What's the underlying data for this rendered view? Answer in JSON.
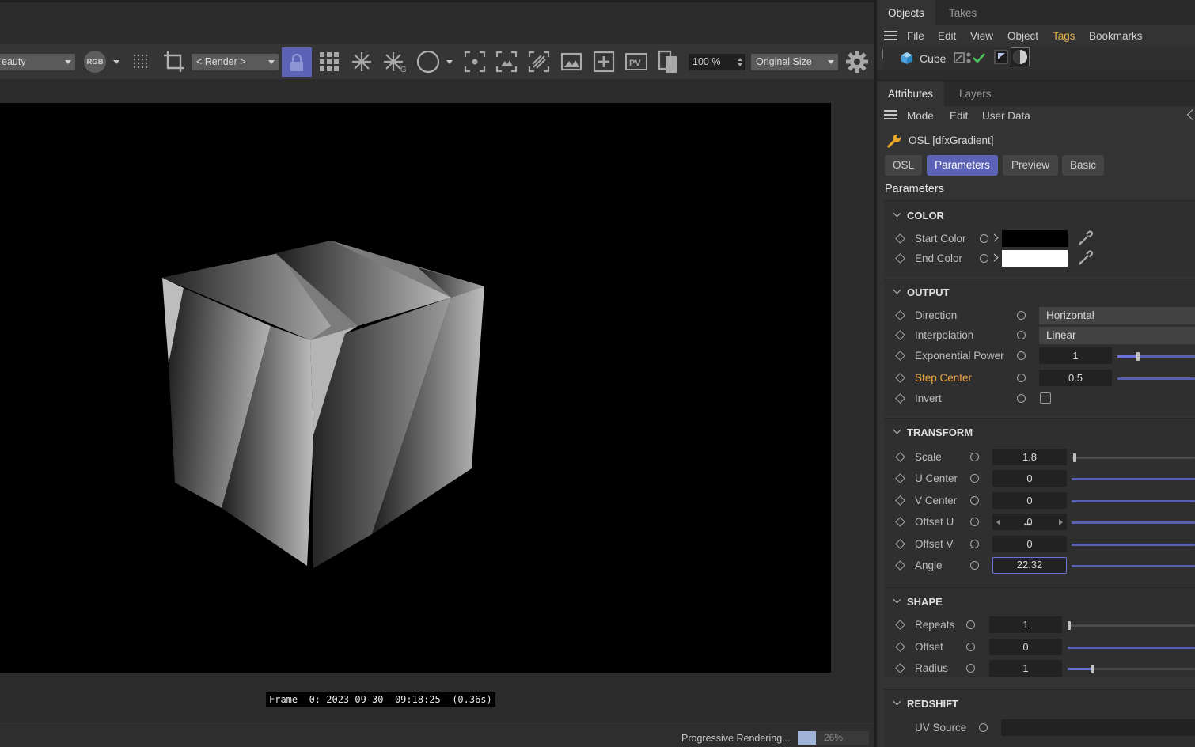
{
  "render_toolbar": {
    "pass_dropdown": "eauty",
    "rgb_label": "RGB",
    "render_dropdown": "< Render >",
    "pv_label": "PV",
    "zoom_value": "100 %",
    "size_dropdown": "Original Size"
  },
  "render_view": {
    "frame_label": "Frame  0: 2023-09-30  09:18:25  (0.36s)",
    "status_text": "Progressive Rendering...",
    "progress_label": "26%",
    "progress_fraction": 0.26
  },
  "top_tabs": [
    "Objects",
    "Takes"
  ],
  "objects_menu": [
    "File",
    "Edit",
    "View",
    "Object",
    "Tags",
    "Bookmarks"
  ],
  "object_row": {
    "name": "Cube"
  },
  "attr_tabs": [
    "Attributes",
    "Layers"
  ],
  "attr_menu": [
    "Mode",
    "Edit",
    "User Data"
  ],
  "attr_title": "OSL [dfxGradient]",
  "pill_tabs": [
    "OSL",
    "Parameters",
    "Preview",
    "Basic"
  ],
  "params_title": "Parameters",
  "groups": {
    "color": {
      "title": "COLOR",
      "start_label": "Start Color",
      "end_label": "End Color",
      "start_color": "#000000",
      "end_color": "#ffffff"
    },
    "output": {
      "title": "OUTPUT",
      "direction_label": "Direction",
      "direction_value": "Horizontal",
      "interpolation_label": "Interpolation",
      "interpolation_value": "Linear",
      "exp_power_label": "Exponential Power",
      "exp_power_value": "1",
      "step_center_label": "Step Center",
      "step_center_value": "0.5",
      "invert_label": "Invert"
    },
    "transform": {
      "title": "TRANSFORM",
      "scale_label": "Scale",
      "scale_value": "1.8",
      "u_center_label": "U Center",
      "u_center_value": "0",
      "v_center_label": "V Center",
      "v_center_value": "0",
      "offset_u_label": "Offset U",
      "offset_u_value": "0",
      "offset_v_label": "Offset V",
      "offset_v_value": "0",
      "angle_label": "Angle",
      "angle_value": "22.32"
    },
    "shape": {
      "title": "SHAPE",
      "repeats_label": "Repeats",
      "repeats_value": "1",
      "offset_label": "Offset",
      "offset_value": "0",
      "radius_label": "Radius",
      "radius_value": "1"
    },
    "redshift": {
      "title": "REDSHIFT",
      "uv_source_label": "UV Source"
    }
  },
  "colors": {
    "accent": "#5c63b6",
    "highlight_label": "#f0a33c",
    "lock_active": "#5c63b6"
  }
}
